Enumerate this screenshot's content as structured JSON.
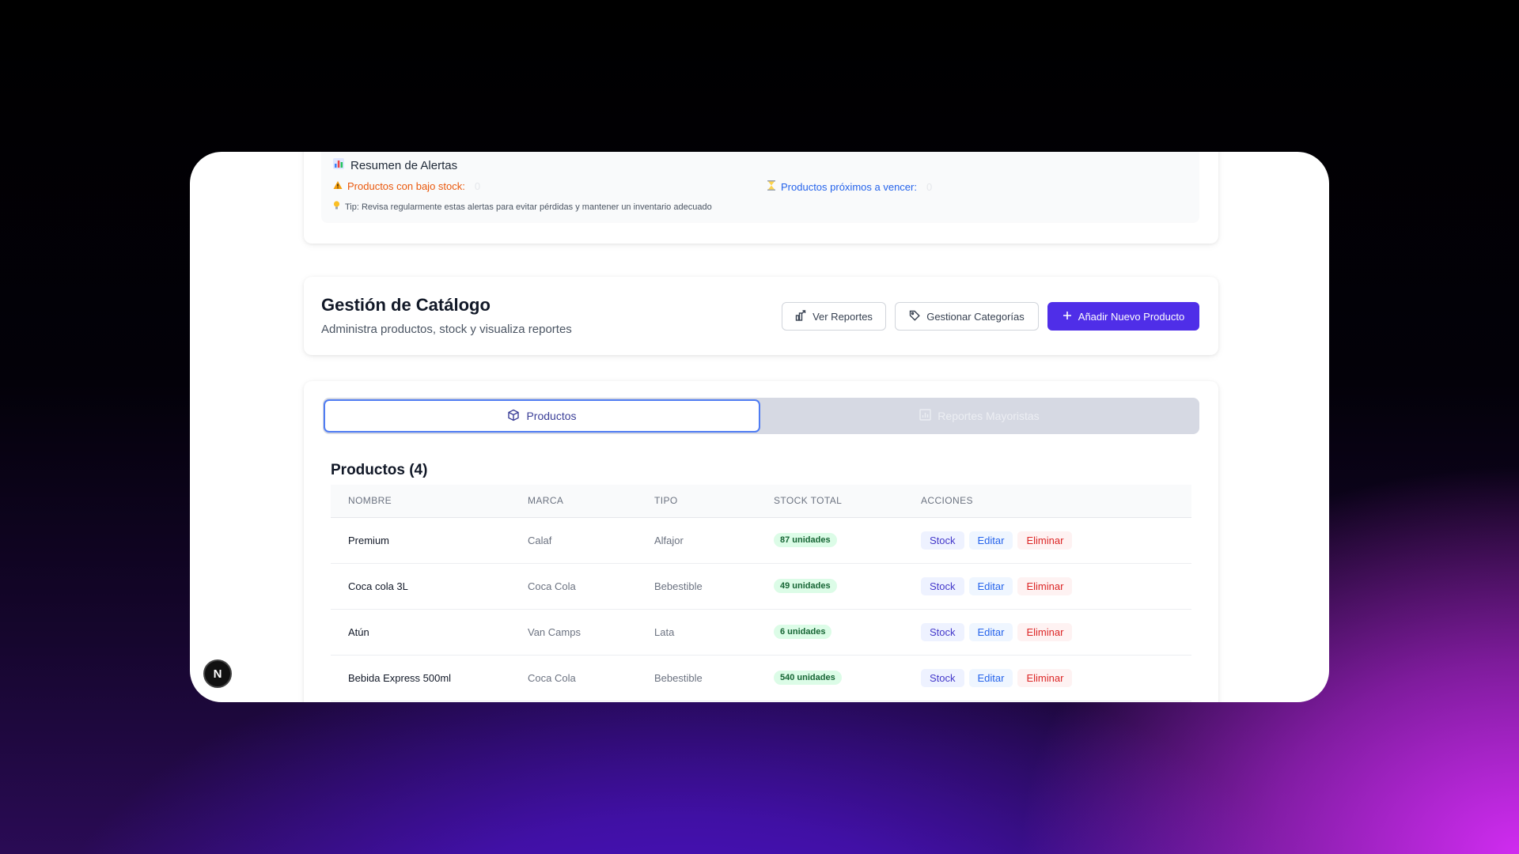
{
  "alerts": {
    "title": "Resumen de Alertas",
    "low_stock_label": "Productos con bajo stock:",
    "low_stock_count": "0",
    "expiring_label": "Productos próximos a vencer:",
    "expiring_count": "0",
    "tip": "Tip: Revisa regularmente estas alertas para evitar pérdidas y mantener un inventario adecuado"
  },
  "catalog": {
    "title": "Gestión de Catálogo",
    "subtitle": "Administra productos, stock y visualiza reportes",
    "buttons": {
      "reportes": "Ver Reportes",
      "categorias": "Gestionar Categorías",
      "nuevo": "Añadir Nuevo Producto"
    }
  },
  "tabs": {
    "productos": "Productos",
    "reportes": "Reportes Mayoristas"
  },
  "products": {
    "title": "Productos (4)",
    "columns": [
      "NOMBRE",
      "MARCA",
      "TIPO",
      "STOCK TOTAL",
      "ACCIONES"
    ],
    "actions": {
      "stock": "Stock",
      "edit": "Editar",
      "delete": "Eliminar"
    },
    "rows": [
      {
        "name": "Premium",
        "brand": "Calaf",
        "type": "Alfajor",
        "stock": "87 unidades"
      },
      {
        "name": "Coca cola 3L",
        "brand": "Coca Cola",
        "type": "Bebestible",
        "stock": "49 unidades"
      },
      {
        "name": "Atún",
        "brand": "Van Camps",
        "type": "Lata",
        "stock": "6 unidades"
      },
      {
        "name": "Bebida Express 500ml",
        "brand": "Coca Cola",
        "type": "Bebestible",
        "stock": "540 unidades"
      }
    ]
  },
  "dev_badge": "N",
  "colors": {
    "primary": "#4f2ee8",
    "warning": "#ea580c",
    "info": "#2563eb",
    "success": "#166534",
    "danger": "#dc2626"
  }
}
